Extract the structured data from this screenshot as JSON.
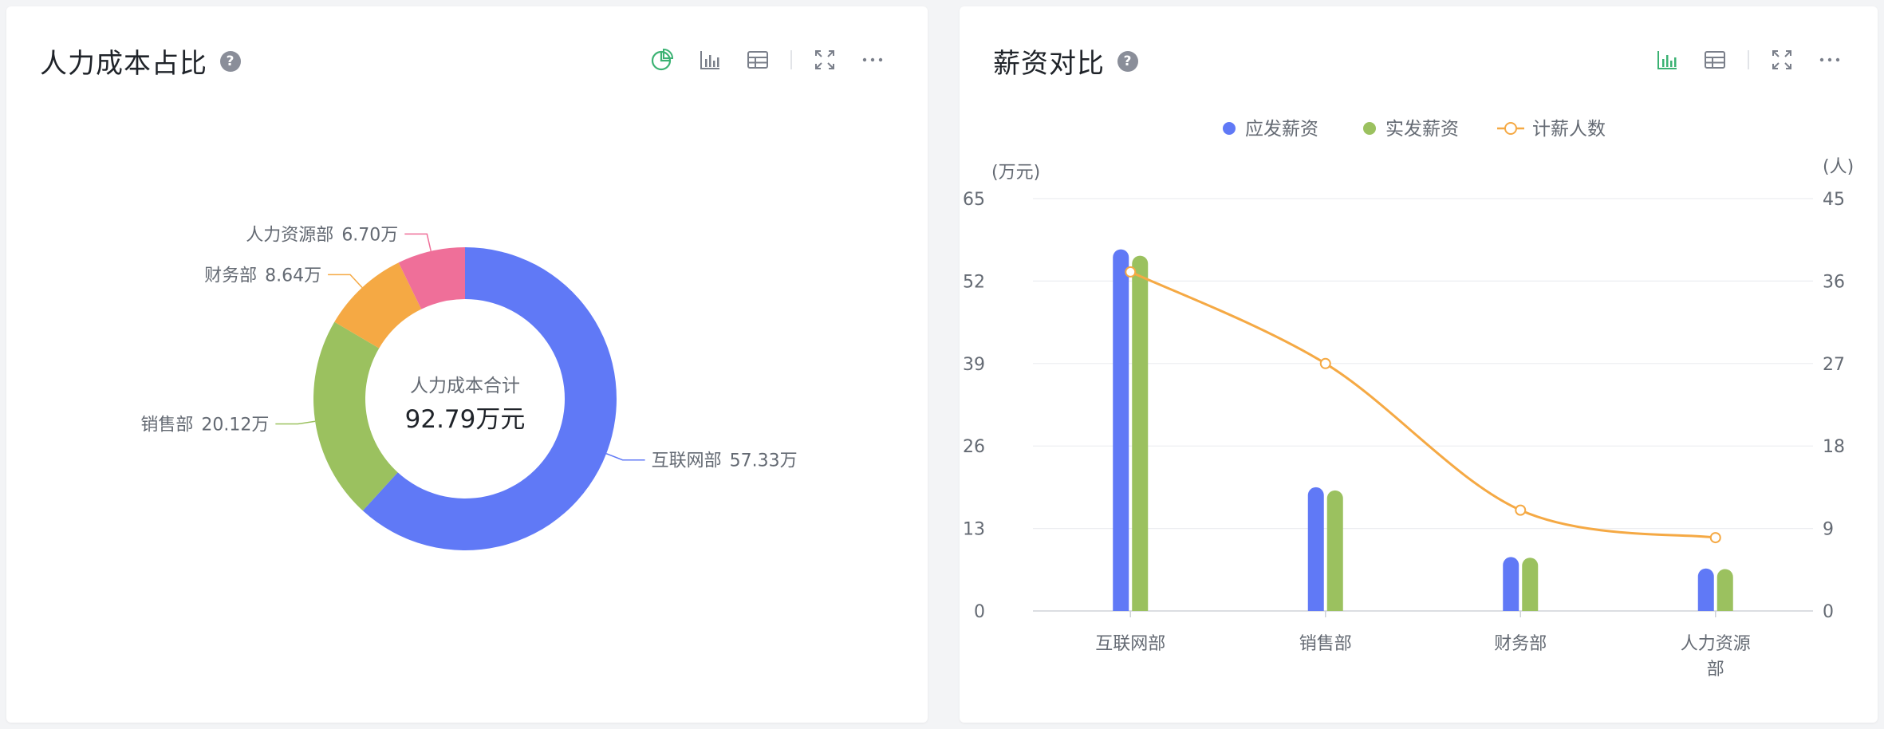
{
  "cards": {
    "left": {
      "title": "人力成本占比",
      "help": "?"
    },
    "right": {
      "title": "薪资对比",
      "help": "?"
    }
  },
  "colors": {
    "blue": "#6079f6",
    "green": "#9bc15f",
    "orange": "#f5a944",
    "pink": "#ef6f99",
    "accent": "#3bb273",
    "icon": "#7a7f8a"
  },
  "icons": {
    "left": [
      "pie-chart-icon",
      "bar-chart-icon",
      "table-icon",
      "fullscreen-icon",
      "more-icon"
    ],
    "right": [
      "bar-chart-icon",
      "table-icon",
      "fullscreen-icon",
      "more-icon"
    ]
  },
  "chart_data": [
    {
      "type": "pie",
      "variant": "donut",
      "center_label": "人力成本合计",
      "center_value": "92.79万元",
      "slices": [
        {
          "name": "互联网部",
          "value": 57.33,
          "label": "57.33万",
          "color": "#6079f6"
        },
        {
          "name": "销售部",
          "value": 20.12,
          "label": "20.12万",
          "color": "#9bc15f"
        },
        {
          "name": "财务部",
          "value": 8.64,
          "label": "8.64万",
          "color": "#f5a944"
        },
        {
          "name": "人力资源部",
          "value": 6.7,
          "label": "6.70万",
          "color": "#ef6f99"
        }
      ]
    },
    {
      "type": "bar",
      "categories": [
        "互联网部",
        "销售部",
        "财务部",
        "人力资源部"
      ],
      "series": [
        {
          "name": "应发薪资",
          "type": "bar",
          "axis": "left",
          "color": "#6079f6",
          "values": [
            57,
            19.5,
            8.5,
            6.7
          ]
        },
        {
          "name": "实发薪资",
          "type": "bar",
          "axis": "left",
          "color": "#9bc15f",
          "values": [
            56,
            19,
            8.4,
            6.6
          ]
        },
        {
          "name": "计薪人数",
          "type": "line",
          "axis": "right",
          "color": "#f5a944",
          "values": [
            37,
            27,
            11,
            8
          ]
        }
      ],
      "y_left": {
        "unit": "(万元)",
        "ylim": [
          0,
          65
        ],
        "ticks": [
          0,
          13,
          26,
          39,
          52,
          65
        ]
      },
      "y_right": {
        "unit": "(人)",
        "ylim": [
          0,
          45
        ],
        "ticks": [
          "0",
          "9",
          "18",
          "27",
          "36",
          "45"
        ]
      },
      "legend_position": "top",
      "grid": true
    }
  ]
}
